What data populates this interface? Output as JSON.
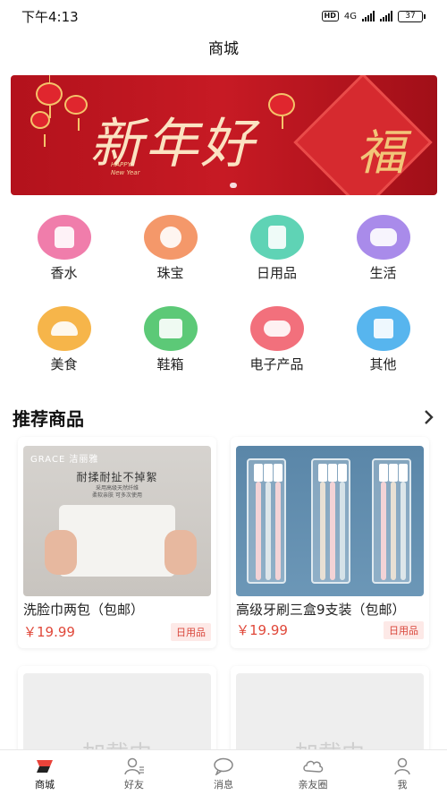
{
  "status_bar": {
    "time": "下午4:13",
    "network": "4G",
    "hd": "HD",
    "battery": "37"
  },
  "page": {
    "title": "商城"
  },
  "banner": {
    "main_text": "新年好",
    "sub_text_line1": "HAPPY",
    "sub_text_line2": "New Year",
    "fu_text": "福"
  },
  "categories": [
    {
      "label": "香水",
      "color": "#f07dab"
    },
    {
      "label": "珠宝",
      "color": "#f4986a"
    },
    {
      "label": "日用品",
      "color": "#5fd3b5"
    },
    {
      "label": "生活",
      "color": "#a98bea"
    },
    {
      "label": "美食",
      "color": "#f6b54a"
    },
    {
      "label": "鞋箱",
      "color": "#5cc977"
    },
    {
      "label": "电子产品",
      "color": "#f2707c"
    },
    {
      "label": "其他",
      "color": "#57b5ee"
    }
  ],
  "recommend": {
    "title": "推荐商品",
    "more_icon": "chevron-right-icon"
  },
  "products": [
    {
      "name": "洗脸巾两包（包邮）",
      "price": "￥19.99",
      "tag": "日用品",
      "image": {
        "brand": "GRACE 洁丽雅",
        "headline": "耐揉耐扯不掉絮",
        "fine_print_1": "采用高级天然纤维",
        "fine_print_2": "柔软亲肤 可多次使用"
      }
    },
    {
      "name": "高级牙刷三盒9支装（包邮）",
      "price": "￥19.99",
      "tag": "日用品"
    }
  ],
  "loading_cards": [
    {
      "text": "加载中"
    },
    {
      "text": "加载中"
    }
  ],
  "bottom_nav": [
    {
      "label": "商城",
      "icon": "mall-icon",
      "active": true
    },
    {
      "label": "好友",
      "icon": "friends-icon",
      "active": false
    },
    {
      "label": "消息",
      "icon": "message-icon",
      "active": false
    },
    {
      "label": "亲友圈",
      "icon": "circle-icon",
      "active": false
    },
    {
      "label": "我",
      "icon": "profile-icon",
      "active": false
    }
  ],
  "colors": {
    "accent": "#e0483a",
    "banner_red": "#b3121c"
  }
}
